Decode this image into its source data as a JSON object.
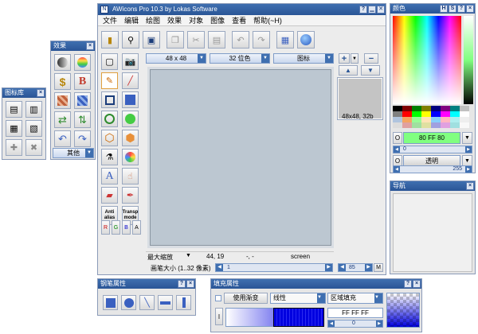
{
  "library": {
    "title": "图标库"
  },
  "effects": {
    "title": "效果",
    "other_label": "其他"
  },
  "main": {
    "title": "AWicons Pro 10.3 by Lokas Software",
    "menu": [
      "文件",
      "编辑",
      "绘图",
      "效果",
      "对象",
      "图像",
      "查看",
      "帮助(~H)"
    ],
    "size_combo": "48 x 48",
    "color_combo": "32 位色",
    "type_combo": "图标",
    "preview_caption": "48x48, 32b",
    "zoom_label": "最大缩放",
    "coords": "44, 19",
    "dash": "-, -",
    "screen": "screen",
    "pen_size_label": "画笔大小 (1..32 像素)",
    "pen_size_value": "1",
    "zoom_value": "85",
    "m_label": "M",
    "antialias": [
      "Anti",
      "alias"
    ],
    "transparent": [
      "Transp",
      "mode"
    ],
    "channels": [
      "R",
      "G",
      "B",
      "A"
    ]
  },
  "color_panel": {
    "title": "颜色",
    "title_btns": [
      "H",
      "S",
      "?"
    ],
    "fg_label": "O",
    "hex": "80 FF 80",
    "fg_value": "0",
    "transparent_label": "透明",
    "alpha_value": "255",
    "accent": "#80ff80"
  },
  "navigator": {
    "title": "导航"
  },
  "brush": {
    "title": "钢笔属性"
  },
  "fill": {
    "title": "填充属性",
    "gradient_label": "使用渐变",
    "mode": "线性",
    "area": "区域填充",
    "hex": "FF FF FF",
    "value": "0",
    "i_label": "I"
  }
}
